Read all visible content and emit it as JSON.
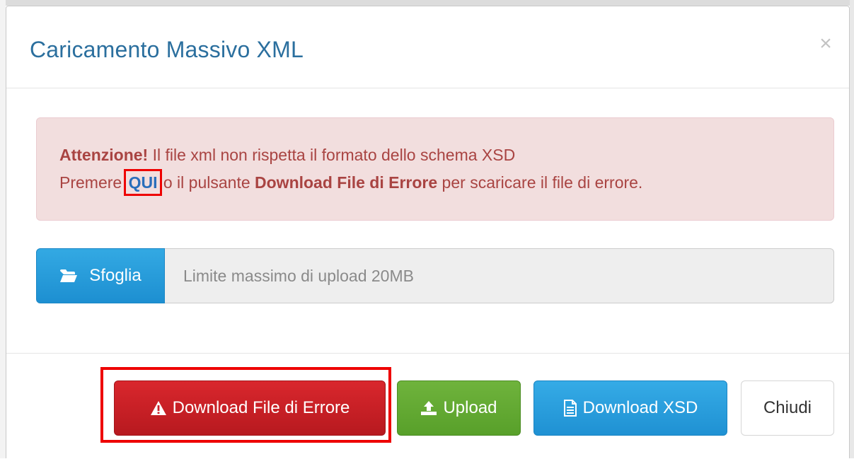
{
  "dialog": {
    "title": "Caricamento Massivo XML",
    "close_glyph": "×"
  },
  "alert": {
    "strong_text": "Attenzione!",
    "line1_text": " Il file xml non rispetta il formato dello schema XSD",
    "line2_prefix": "Premere ",
    "link_text": "QUI",
    "line2_middle": " o il pulsante ",
    "line2_bold": "Download File di Errore",
    "line2_suffix": " per scaricare il file di errore."
  },
  "file_upload": {
    "browse_label": "Sfoglia",
    "browse_icon": "folder-open-icon",
    "placeholder": "Limite massimo di upload 20MB"
  },
  "footer": {
    "buttons": [
      {
        "label": "Download File di Errore",
        "icon": "warning-icon",
        "color": "#c9202a"
      },
      {
        "label": "Upload",
        "icon": "upload-icon",
        "color": "#62a932"
      },
      {
        "label": "Download XSD",
        "icon": "document-icon",
        "color": "#2a9ddc"
      },
      {
        "label": "Chiudi",
        "icon": "",
        "color": "#ffffff"
      }
    ]
  },
  "colors": {
    "title": "#2b6f9e",
    "alert_bg": "#f2dede",
    "alert_text": "#a94442",
    "link": "#2a6ebb",
    "highlight": "#ee0000"
  }
}
